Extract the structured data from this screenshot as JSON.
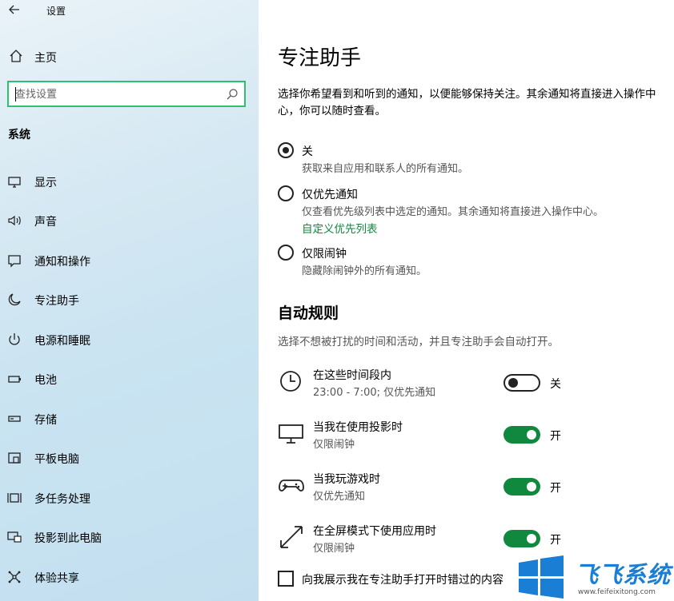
{
  "window": {
    "title": "设置"
  },
  "sidebar": {
    "home_label": "主页",
    "search": {
      "placeholder": "查找设置"
    },
    "section": "系统",
    "items": [
      {
        "label": "显示",
        "icon": "monitor-icon"
      },
      {
        "label": "声音",
        "icon": "speaker-icon"
      },
      {
        "label": "通知和操作",
        "icon": "message-icon"
      },
      {
        "label": "专注助手",
        "icon": "moon-icon"
      },
      {
        "label": "电源和睡眠",
        "icon": "power-icon"
      },
      {
        "label": "电池",
        "icon": "battery-icon"
      },
      {
        "label": "存储",
        "icon": "storage-icon"
      },
      {
        "label": "平板电脑",
        "icon": "tablet-icon"
      },
      {
        "label": "多任务处理",
        "icon": "multitask-icon"
      },
      {
        "label": "投影到此电脑",
        "icon": "project-icon"
      },
      {
        "label": "体验共享",
        "icon": "share-icon"
      }
    ]
  },
  "main": {
    "title": "专注助手",
    "intro": "选择你希望看到和听到的通知，以便能够保持关注。其余通知将直接进入操作中心，你可以随时查看。",
    "options": [
      {
        "label": "关",
        "desc": "获取来自应用和联系人的所有通知。",
        "selected": true
      },
      {
        "label": "仅优先通知",
        "desc": "仅查看优先级列表中选定的通知。其余通知将直接进入操作中心。",
        "link": "自定义优先列表",
        "selected": false
      },
      {
        "label": "仅限闹钟",
        "desc": "隐藏除闹钟外的所有通知。",
        "selected": false
      }
    ],
    "auto_rules": {
      "title": "自动规则",
      "intro": "选择不想被打扰的时间和活动，并且专注助手会自动打开。",
      "rules": [
        {
          "title": "在这些时间段内",
          "sub": "23:00 - 7:00; 仅优先通知",
          "state": "关",
          "on": false,
          "icon": "clock-icon"
        },
        {
          "title": "当我在使用投影时",
          "sub": "仅限闹钟",
          "state": "开",
          "on": true,
          "icon": "monitor-icon"
        },
        {
          "title": "当我玩游戏时",
          "sub": "仅优先通知",
          "state": "开",
          "on": true,
          "icon": "gamepad-icon"
        },
        {
          "title": "在全屏模式下使用应用时",
          "sub": "仅限闹钟",
          "state": "开",
          "on": true,
          "icon": "fullscreen-icon"
        }
      ]
    },
    "checkbox_label": "向我展示我在专注助手打开时错过的内容"
  },
  "watermark": {
    "brand": "飞飞系统",
    "url": "www.feifeixitong.com",
    "accent": "#1a7fd4"
  },
  "colors": {
    "accent_green": "#10893e",
    "search_border": "#2fbf71"
  }
}
